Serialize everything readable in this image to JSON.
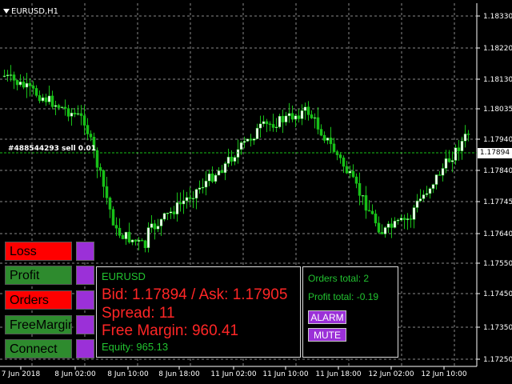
{
  "chart": {
    "title": "EURUSD,H1",
    "order_label": "#488544293 sell 0.01",
    "current_price": "1.17894",
    "price_axis": [
      "1.18330",
      "1.18220",
      "1.18130",
      "1.18035",
      "1.17940",
      "1.17840",
      "1.17745",
      "1.17640",
      "1.17550",
      "1.17450",
      "1.17350",
      "1.17250"
    ],
    "time_axis": [
      "7 Jun 2018",
      "8 Jun 02:00",
      "8 Jun 10:00",
      "8 Jun 18:00",
      "11 Jun 02:00",
      "11 Jun 10:00",
      "11 Jun 18:00",
      "12 Jun 02:00",
      "12 Jun 10:00"
    ],
    "colors": {
      "bull": "#ffffff",
      "bear": "#18c018",
      "grid": "#8a8a8a",
      "order_line": "#18c018"
    }
  },
  "side_buttons": [
    {
      "label": "Loss",
      "color": "#ff0000"
    },
    {
      "label": "Profit",
      "color": "#2e8b2e"
    },
    {
      "label": "Orders",
      "color": "#ff0000"
    },
    {
      "label": "FreeMargin",
      "color": "#2e8b2e"
    },
    {
      "label": "Connect",
      "color": "#2e8b2e"
    }
  ],
  "info_panel": {
    "symbol": "EURUSD",
    "bid_ask": "Bid: 1.17894 / Ask: 1.17905",
    "spread": "Spread: 11",
    "free_margin": "Free Margin: 960.41",
    "equity": "Equity: 965.13"
  },
  "orders_panel": {
    "orders_total": "Orders total: 2",
    "profit_total": "Profit total: -0.19",
    "alarm_label": "ALARM",
    "mute_label": "MUTE"
  }
}
